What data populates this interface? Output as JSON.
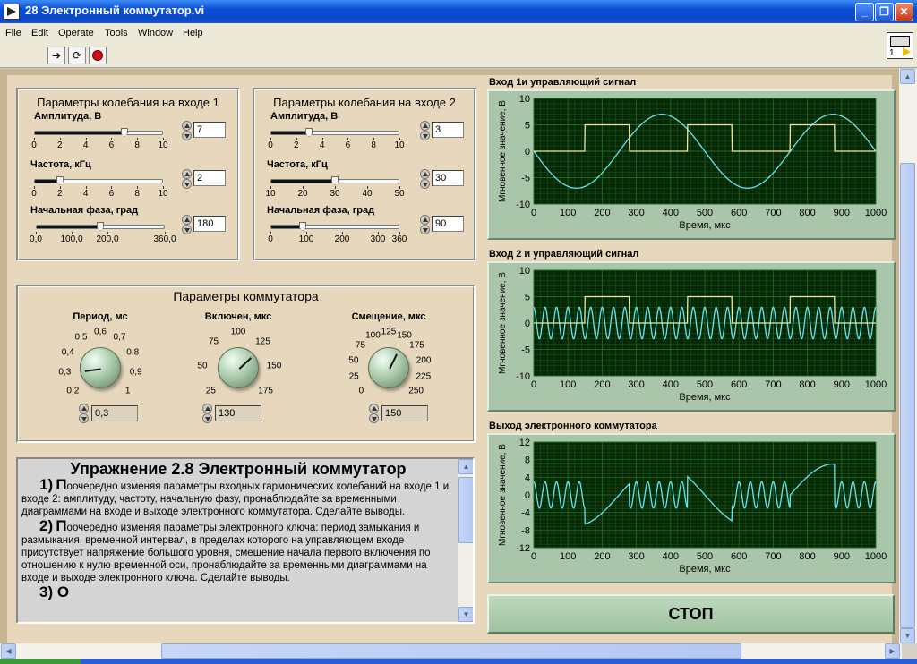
{
  "window": {
    "title": "28 Электронный коммутатор.vi",
    "controls": [
      "_",
      "❐",
      "✕"
    ]
  },
  "menu": [
    "File",
    "Edit",
    "Operate",
    "Tools",
    "Window",
    "Help"
  ],
  "vi_icon_number": "1",
  "input1": {
    "title": "Параметры колебания на входе 1",
    "amplitude": {
      "label": "Амплитуда, В",
      "value": "7",
      "min": 0,
      "max": 10,
      "current": 7,
      "ticks": [
        "0",
        "2",
        "4",
        "6",
        "8",
        "10"
      ]
    },
    "frequency": {
      "label": "Частота, кГц",
      "value": "2",
      "min": 0,
      "max": 10,
      "current": 2,
      "ticks": [
        "0",
        "2",
        "4",
        "6",
        "8",
        "10"
      ]
    },
    "phase": {
      "label": "Начальная фаза, град",
      "value": "180",
      "min": 0,
      "max": 360,
      "current": 180,
      "ticks": [
        "0,0",
        "100,0",
        "200,0",
        "360,0"
      ],
      "tick_values": [
        0,
        100,
        200,
        360
      ]
    }
  },
  "input2": {
    "title": "Параметры колебания на входе 2",
    "amplitude": {
      "label": "Амплитуда, В",
      "value": "3",
      "min": 0,
      "max": 10,
      "current": 3,
      "ticks": [
        "0",
        "2",
        "4",
        "6",
        "8",
        "10"
      ]
    },
    "frequency": {
      "label": "Частота, кГц",
      "value": "30",
      "min": 10,
      "max": 50,
      "current": 30,
      "ticks": [
        "10",
        "20",
        "30",
        "40",
        "50"
      ]
    },
    "phase": {
      "label": "Начальная фаза, град",
      "value": "90",
      "min": 0,
      "max": 360,
      "current": 90,
      "ticks": [
        "0",
        "100",
        "200",
        "300",
        "360"
      ],
      "tick_values": [
        0,
        100,
        200,
        300,
        360
      ]
    }
  },
  "commutator": {
    "title": "Параметры коммутатора",
    "period": {
      "label": "Период, мс",
      "value": "0,3",
      "scale": [
        "0,2",
        "0,3",
        "0,4",
        "0,5",
        "0,6",
        "0,7",
        "0,8",
        "0,9",
        "1"
      ]
    },
    "on": {
      "label": "Включен, мкс",
      "value": "130",
      "scale": [
        "25",
        "50",
        "75",
        "100",
        "125",
        "150",
        "175"
      ]
    },
    "offset": {
      "label": "Смещение, мкс",
      "value": "150",
      "scale": [
        "0",
        "25",
        "50",
        "75",
        "100",
        "125",
        "150",
        "175",
        "200",
        "225",
        "250"
      ]
    }
  },
  "exercise": {
    "heading": "Упражнение 2.8 Электронный коммутатор",
    "p1_num": "1)",
    "p1_first": "П",
    "p1_rest": "оочередно изменяя параметры входных гармонических колебаний на входе 1 и входе 2: амплитуду, частоту, начальную фазу,  пронаблюдайте за временными диаграммами на входе и выходе электронного коммутатора. Сделайте выводы.",
    "p2_num": "2)",
    "p2_first": "П",
    "p2_rest": "оочередно изменяя параметры электронного ключа: период замыкания и размыкания, временной интервал, в пределах которого на управляющем входе присутствует напряжение большого уровня, смещение начала первого включения по отношению к нулю временной оси,  пронаблюдайте за временными диаграммами на входе и выходе электронного ключа. Сделайте выводы.",
    "p3_partial": "3) О"
  },
  "stop_label": "СТОП",
  "colors": {
    "plot_bg": "#062806",
    "grid": "#1f6a1f",
    "signal": "#66e5f0",
    "control": "#f2e9a0",
    "frame": "#a9c6aa"
  },
  "chart_data": [
    {
      "type": "line",
      "title": "Вход 1и управляющий сигнал",
      "xlabel": "Время, мкс",
      "ylabel": "Мгновенное значение, В",
      "xlim": [
        0,
        1000
      ],
      "ylim": [
        -10,
        10
      ],
      "xticks": [
        0,
        100,
        200,
        300,
        400,
        500,
        600,
        700,
        800,
        900,
        1000
      ],
      "yticks": [
        -10,
        -5,
        0,
        5,
        10
      ],
      "series": [
        {
          "kind": "sine",
          "amplitude": 7,
          "frequency_khz": 2,
          "phase_deg": 180
        },
        {
          "kind": "pulse",
          "high": 5,
          "low": 0,
          "period_us": 300,
          "width_us": 130,
          "offset_us": 150
        }
      ]
    },
    {
      "type": "line",
      "title": "Вход 2 и управляющий сигнал",
      "xlabel": "Время, мкс",
      "ylabel": "Мгновенное значение, В",
      "xlim": [
        0,
        1000
      ],
      "ylim": [
        -10,
        10
      ],
      "xticks": [
        0,
        100,
        200,
        300,
        400,
        500,
        600,
        700,
        800,
        900,
        1000
      ],
      "yticks": [
        -10,
        -5,
        0,
        5,
        10
      ],
      "series": [
        {
          "kind": "sine",
          "amplitude": 3,
          "frequency_khz": 30,
          "phase_deg": 90
        },
        {
          "kind": "pulse",
          "high": 5,
          "low": 0,
          "period_us": 300,
          "width_us": 130,
          "offset_us": 150
        }
      ]
    },
    {
      "type": "line",
      "title": "Выход электронного коммутатора",
      "xlabel": "Время, мкс",
      "ylabel": "Мгновенное значение, В",
      "xlim": [
        0,
        1000
      ],
      "ylim": [
        -12,
        12
      ],
      "xticks": [
        0,
        100,
        200,
        300,
        400,
        500,
        600,
        700,
        800,
        900,
        1000
      ],
      "yticks": [
        -12,
        -8,
        -4,
        0,
        4,
        8,
        12
      ],
      "series": [
        {
          "kind": "switched",
          "on_source": "input1",
          "off_source": "input2",
          "period_us": 300,
          "width_us": 130,
          "offset_us": 150
        }
      ]
    }
  ]
}
